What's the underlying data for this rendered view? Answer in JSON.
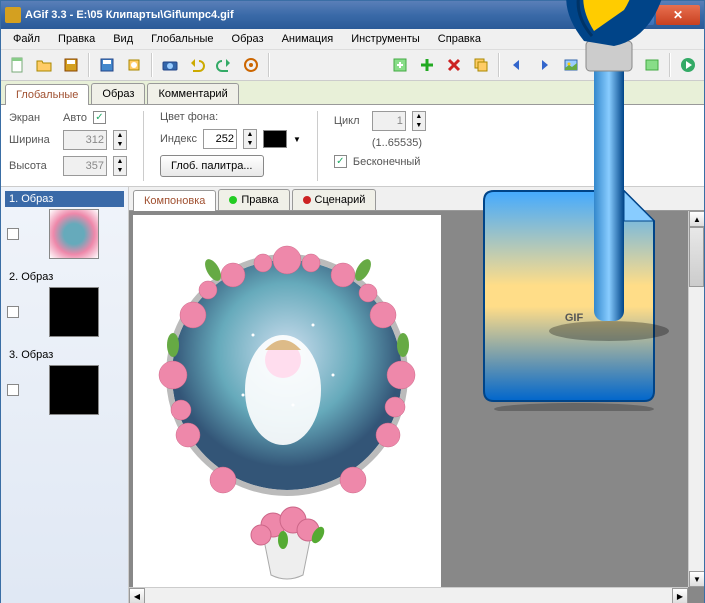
{
  "window": {
    "title": "AGif 3.3 - E:\\05 Клипарты\\Gif\\umpc4.gif"
  },
  "menu": {
    "items": [
      "Файл",
      "Правка",
      "Вид",
      "Глобальные",
      "Образ",
      "Анимация",
      "Инструменты",
      "Справка"
    ]
  },
  "tabs": {
    "globals": "Глобальные",
    "image": "Образ",
    "comment": "Комментарий"
  },
  "settings": {
    "screen_label": "Экран",
    "auto_label": "Авто",
    "width_label": "Ширина",
    "height_label": "Высота",
    "width_val": "312",
    "height_val": "357",
    "bgcolor_label": "Цвет фона:",
    "index_label": "Индекс",
    "index_val": "252",
    "palette_btn": "Глоб. палитра...",
    "loop_label": "Цикл",
    "loop_val": "1",
    "loop_range": "(1..65535)",
    "infinite_label": "Бесконечный"
  },
  "frames": [
    {
      "label": "1. Образ"
    },
    {
      "label": "2. Образ"
    },
    {
      "label": "3. Образ"
    }
  ],
  "editor_tabs": {
    "layout": "Компоновка",
    "edit": "Правка",
    "script": "Сценарий"
  },
  "overlay": {
    "gif_text": "GIF"
  }
}
